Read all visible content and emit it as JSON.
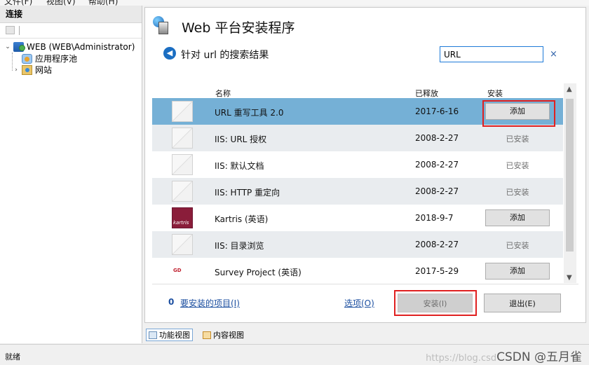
{
  "menubar": {
    "items": [
      "文件(F)",
      "视图(V)",
      "帮助(H)"
    ]
  },
  "connections": {
    "header": "连接",
    "tree": [
      {
        "label": "WEB (WEB\\Administrator)",
        "expanded": true,
        "icon": "server-icon"
      },
      {
        "label": "应用程序池",
        "icon": "app-pool-icon"
      },
      {
        "label": "网站",
        "icon": "sites-icon"
      }
    ]
  },
  "dialog": {
    "title": "Web 平台安装程序",
    "subtitle": "针对 url 的搜索结果",
    "search_value": "URL",
    "clear_glyph": "×",
    "columns": {
      "name": "名称",
      "released": "已释放",
      "install": "安装"
    },
    "rows": [
      {
        "name": "URL 重写工具 2.0",
        "date": "2017-6-16",
        "action": "添加",
        "installed": false,
        "selected": true,
        "thumb": "placeholder"
      },
      {
        "name": "IIS: URL 授权",
        "date": "2008-2-27",
        "action": "已安装",
        "installed": true,
        "selected": false,
        "thumb": "placeholder"
      },
      {
        "name": "IIS: 默认文档",
        "date": "2008-2-27",
        "action": "已安装",
        "installed": true,
        "selected": false,
        "thumb": "placeholder"
      },
      {
        "name": "IIS: HTTP 重定向",
        "date": "2008-2-27",
        "action": "已安装",
        "installed": true,
        "selected": false,
        "thumb": "placeholder"
      },
      {
        "name": "Kartris (英语)",
        "date": "2018-9-7",
        "action": "添加",
        "installed": false,
        "selected": false,
        "thumb": "kartris"
      },
      {
        "name": "IIS: 目录浏览",
        "date": "2008-2-27",
        "action": "已安装",
        "installed": true,
        "selected": false,
        "thumb": "placeholder"
      },
      {
        "name": "Survey Project (英语)",
        "date": "2017-5-29",
        "action": "添加",
        "installed": false,
        "selected": false,
        "thumb": "survey"
      }
    ],
    "footer": {
      "count": "0",
      "items_link": "要安装的项目(I)",
      "options_link": "选项(O)",
      "install_label": "安装(I)",
      "exit_label": "退出(E)"
    }
  },
  "views": {
    "features": "功能视图",
    "content": "内容视图"
  },
  "status": {
    "text": "就绪"
  },
  "watermark": {
    "url": "https://blog.csd",
    "text": "CSDN @五月雀"
  },
  "colors": {
    "selected_row": "#75b0d6",
    "highlight": "#e02020",
    "link": "#1c4fa0"
  }
}
